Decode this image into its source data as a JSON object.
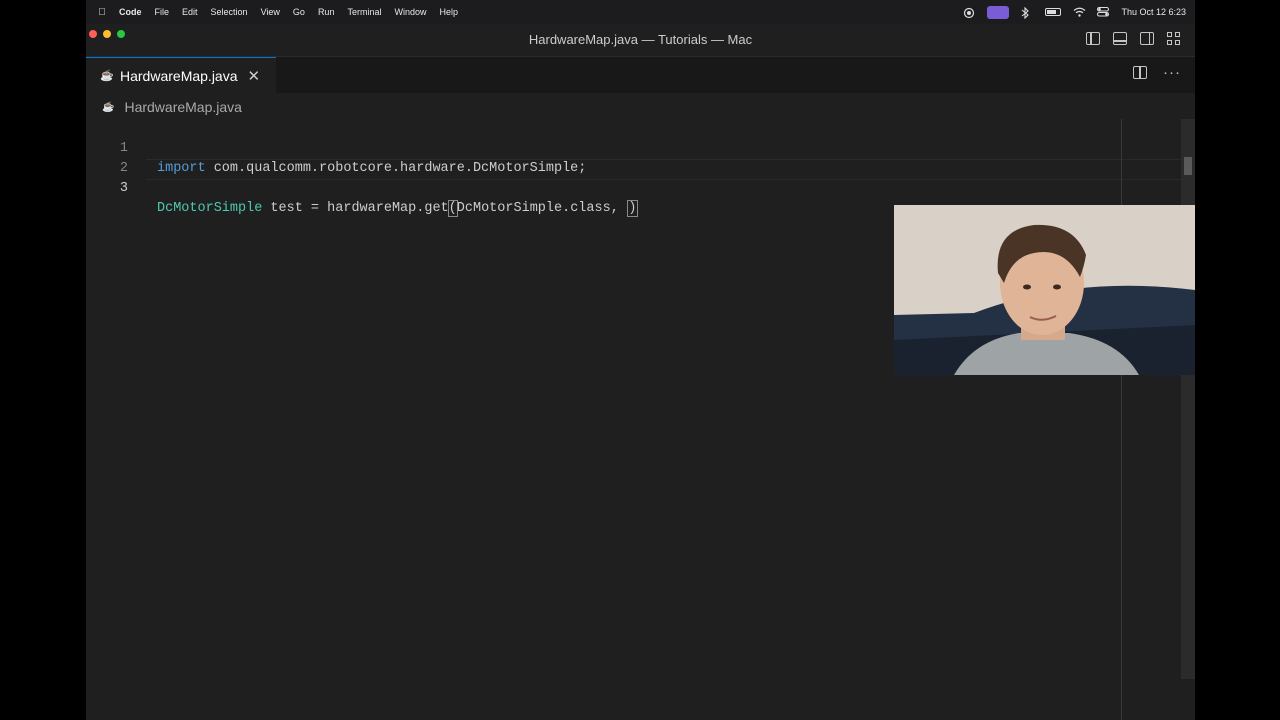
{
  "menubar": {
    "app": "Code",
    "items": [
      "File",
      "Edit",
      "Selection",
      "View",
      "Go",
      "Run",
      "Terminal",
      "Window",
      "Help"
    ],
    "clock": "Thu Oct 12  6:23"
  },
  "window": {
    "title": "HardwareMap.java — Tutorials — Mac"
  },
  "tab": {
    "label": "HardwareMap.java",
    "close": "✕"
  },
  "breadcrumb": {
    "file": "HardwareMap.java"
  },
  "editor": {
    "lines": [
      {
        "num": "1",
        "kw": "import",
        "text": " com.qualcomm.robotcore.hardware.DcMotorSimple;"
      },
      {
        "num": "2"
      },
      {
        "num": "3",
        "type": "DcMotorSimple",
        "a": " test = hardwareMap.get",
        "paren": "(",
        "b": "DcMotorSimple.class, ",
        "close": ")"
      }
    ]
  },
  "colors": {
    "accent": "#0078d4",
    "keyword": "#569cd6",
    "type": "#4ec9b0",
    "editor_bg": "#1f1f1f"
  }
}
